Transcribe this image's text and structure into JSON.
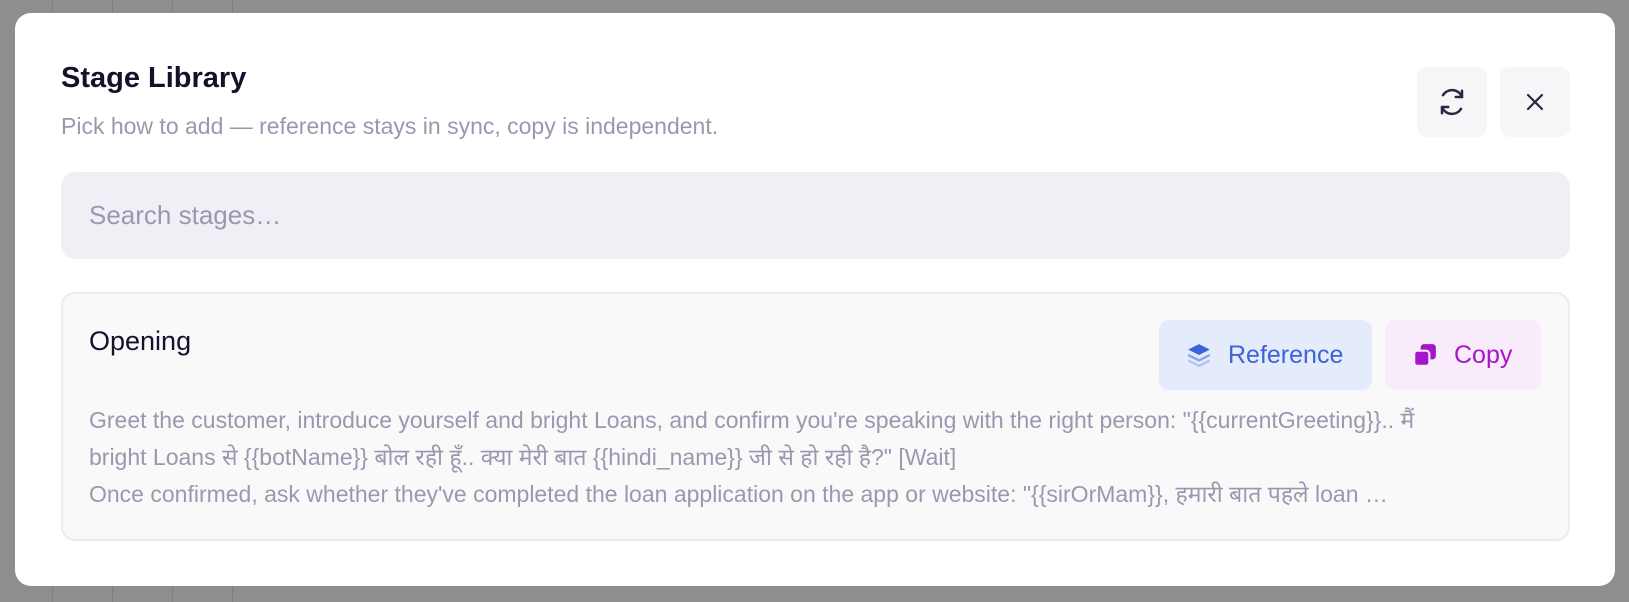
{
  "modal": {
    "title": "Stage Library",
    "subtitle": "Pick how to add — reference stays in sync, copy is independent."
  },
  "toolbar": {
    "refresh_icon": "refresh-icon",
    "close_icon": "close-icon"
  },
  "search": {
    "placeholder": "Search stages…",
    "value": ""
  },
  "stages": [
    {
      "name": "Opening",
      "reference_label": "Reference",
      "reference_icon": "layers-icon",
      "copy_label": "Copy",
      "copy_icon": "copy-icon",
      "description_lines": [
        "Greet the customer, introduce yourself and bright Loans, and confirm you're speaking with the right person: \"{{currentGreeting}}.. मैं",
        "bright Loans से {{botName}} बोल रही हूँ.. क्या मेरी बात {{hindi_name}} जी से हो रही है?\" [Wait]",
        "Once confirmed, ask whether they've completed the loan application on the app or website: \"{{sirOrMam}}, हमारी बात पहले loan …"
      ]
    }
  ],
  "colors": {
    "reference": "#3e62d8",
    "copy": "#a516c8",
    "title": "#14112b",
    "muted": "#9a98af"
  }
}
